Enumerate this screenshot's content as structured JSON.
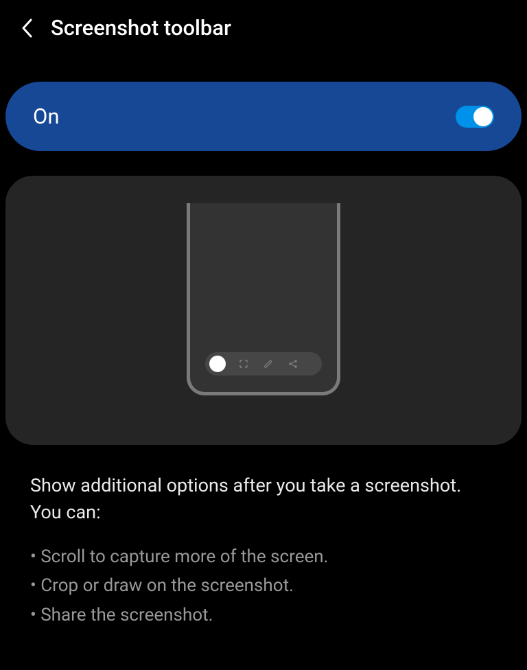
{
  "header": {
    "title": "Screenshot toolbar"
  },
  "toggle": {
    "label": "On",
    "state": true
  },
  "description": {
    "title": "Show additional options after you take a screenshot. You can:",
    "items": [
      "Scroll to capture more of the screen.",
      "Crop or draw on the screenshot.",
      "Share the screenshot."
    ]
  }
}
